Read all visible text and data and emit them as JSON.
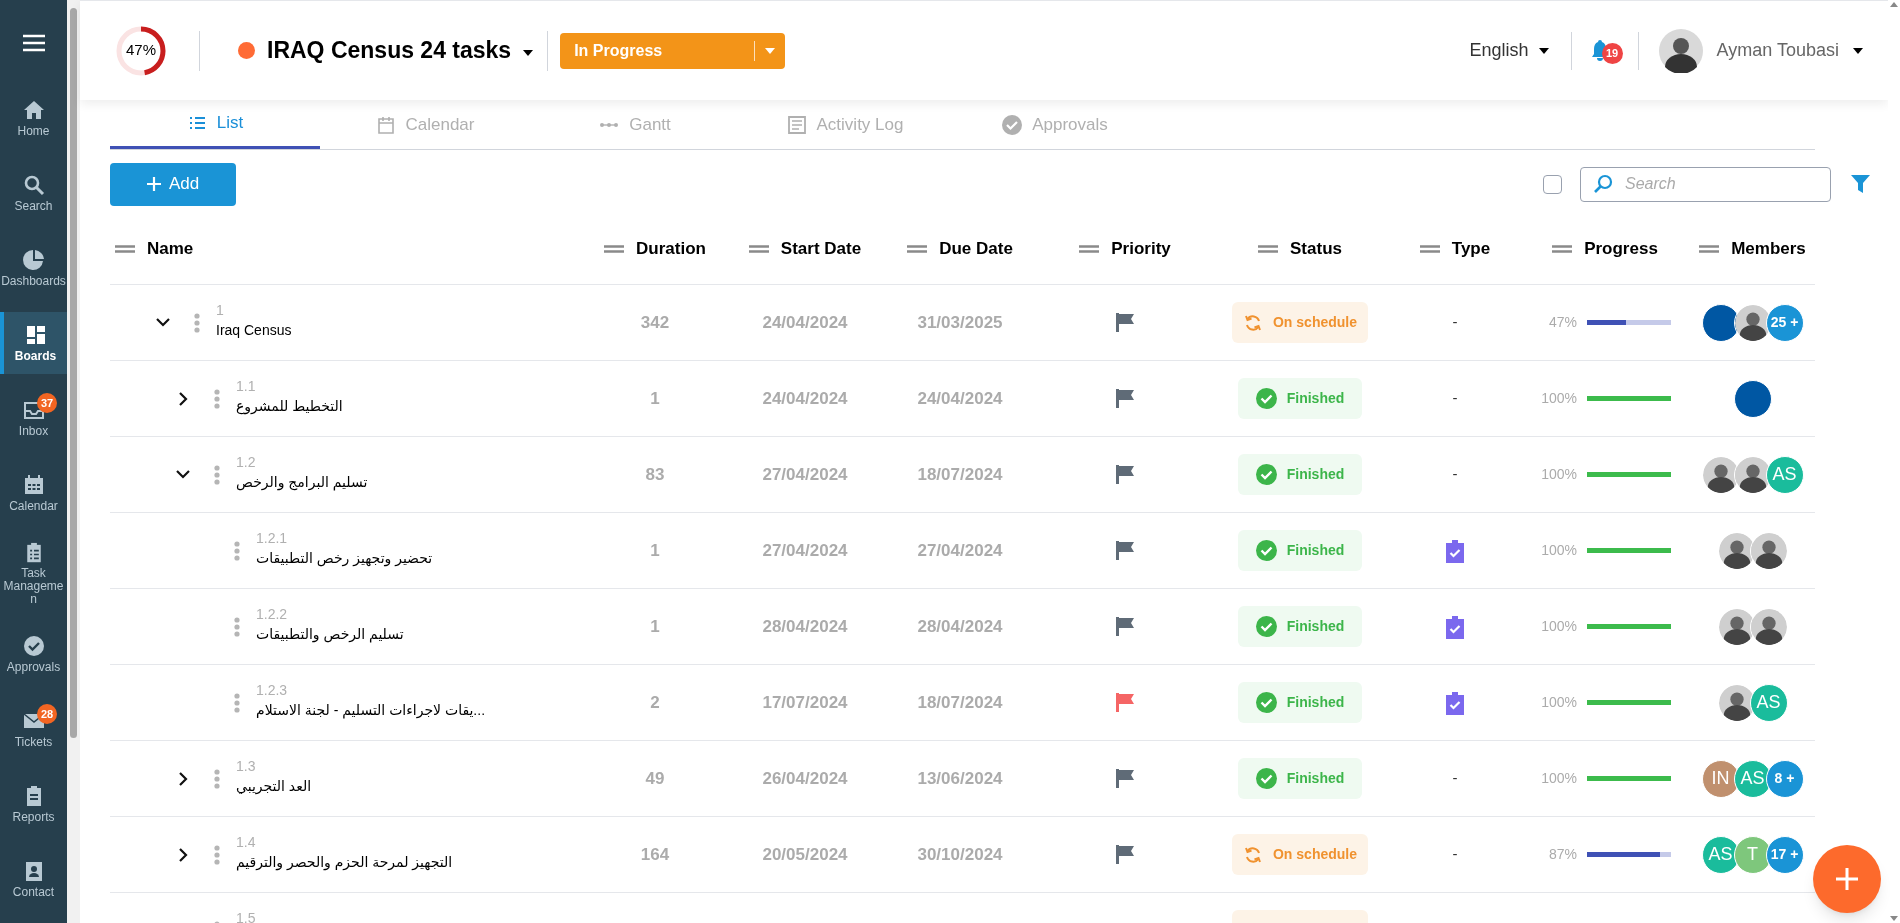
{
  "sidebar": {
    "items": [
      {
        "label": "Home",
        "selected": false
      },
      {
        "label": "Search",
        "selected": false
      },
      {
        "label": "Dashboards",
        "selected": false
      },
      {
        "label": "Boards",
        "selected": true
      },
      {
        "label": "Inbox",
        "selected": false,
        "badge": "37"
      },
      {
        "label": "Calendar",
        "selected": false
      },
      {
        "label": "Task Managemen",
        "selected": false
      },
      {
        "label": "Approvals",
        "selected": false
      },
      {
        "label": "Tickets",
        "selected": false,
        "badge": "28"
      },
      {
        "label": "Reports",
        "selected": false
      },
      {
        "label": "Contact",
        "selected": false
      }
    ]
  },
  "header": {
    "progress": {
      "text": "47%",
      "level": 0.47
    },
    "project_title": "IRAQ Census 24 tasks",
    "status_dropdown": "In Progress",
    "language": "English",
    "notifications": "19",
    "user_name": "Ayman Toubasi"
  },
  "tabs": [
    {
      "label": "List",
      "selected": true
    },
    {
      "label": "Calendar",
      "selected": false
    },
    {
      "label": "Gantt",
      "selected": false
    },
    {
      "label": "Activity Log",
      "selected": false
    },
    {
      "label": "Approvals",
      "selected": false
    }
  ],
  "toolbar": {
    "add_button": "Add",
    "select_all_checked": false,
    "search": {
      "placeholder": "Search"
    }
  },
  "table": {
    "columns": [
      "Name",
      "Duration",
      "Start Date",
      "Due Date",
      "Priority",
      "Status",
      "Type",
      "Progress",
      "Members"
    ],
    "rows": [
      {
        "number": "1",
        "name": "Iraq Census",
        "expanded": true,
        "duration": "342",
        "start": "24/04/2024",
        "due": "31/03/2025",
        "priority": {
          "kind": "normal"
        },
        "status": {
          "kind": "on_schedule",
          "label": "On schedule"
        },
        "type": {
          "kind": "dash",
          "text": "-"
        },
        "progress": {
          "text": "47%",
          "level": 0.47
        },
        "members": [
          {
            "kind": "plain",
            "color": "#0057a3"
          },
          {
            "kind": "photo"
          },
          {
            "kind": "more",
            "text": "25 +",
            "color": "#1a94d6"
          }
        ],
        "children": [
          {
            "number": "1.1",
            "name": "التخطيط للمشروع",
            "expanded": false,
            "duration": "1",
            "start": "24/04/2024",
            "due": "24/04/2024",
            "priority": {
              "kind": "normal"
            },
            "status": {
              "kind": "finished",
              "label": "Finished"
            },
            "type": {
              "kind": "dash",
              "text": "-"
            },
            "progress": {
              "text": "100%",
              "level": 1
            },
            "members": [
              {
                "kind": "plain",
                "color": "#0057a3"
              }
            ]
          },
          {
            "number": "1.2",
            "name": "تسليم البرامج والرخص",
            "expanded": true,
            "duration": "83",
            "start": "27/04/2024",
            "due": "18/07/2024",
            "priority": {
              "kind": "normal"
            },
            "status": {
              "kind": "finished",
              "label": "Finished"
            },
            "type": {
              "kind": "dash",
              "text": "-"
            },
            "progress": {
              "text": "100%",
              "level": 1
            },
            "members": [
              {
                "kind": "photo"
              },
              {
                "kind": "photo"
              },
              {
                "kind": "initials",
                "text": "AS",
                "color": "#1abc9c"
              }
            ],
            "children": [
              {
                "number": "1.2.1",
                "name": "تحضير وتجهيز رخص التطبيقات",
                "duration": "1",
                "start": "27/04/2024",
                "due": "27/04/2024",
                "priority": {
                  "kind": "normal"
                },
                "status": {
                  "kind": "finished",
                  "label": "Finished"
                },
                "type": {
                  "kind": "task"
                },
                "progress": {
                  "text": "100%",
                  "level": 1
                },
                "members": [
                  {
                    "kind": "photo"
                  },
                  {
                    "kind": "photo"
                  }
                ]
              },
              {
                "number": "1.2.2",
                "name": "تسليم الرخص والتطبيقات",
                "duration": "1",
                "start": "28/04/2024",
                "due": "28/04/2024",
                "priority": {
                  "kind": "normal"
                },
                "status": {
                  "kind": "finished",
                  "label": "Finished"
                },
                "type": {
                  "kind": "task"
                },
                "progress": {
                  "text": "100%",
                  "level": 1
                },
                "members": [
                  {
                    "kind": "photo"
                  },
                  {
                    "kind": "photo"
                  }
                ]
              },
              {
                "number": "1.2.3",
                "name": "...يقات لاجراءات التسليم - لجنة الاستلام",
                "duration": "2",
                "start": "17/07/2024",
                "due": "18/07/2024",
                "priority": {
                  "kind": "urgent"
                },
                "status": {
                  "kind": "finished",
                  "label": "Finished"
                },
                "type": {
                  "kind": "task"
                },
                "progress": {
                  "text": "100%",
                  "level": 1
                },
                "members": [
                  {
                    "kind": "photo"
                  },
                  {
                    "kind": "initials",
                    "text": "AS",
                    "color": "#1abc9c"
                  }
                ]
              }
            ]
          },
          {
            "number": "1.3",
            "name": "العد التجريبي",
            "expanded": false,
            "duration": "49",
            "start": "26/04/2024",
            "due": "13/06/2024",
            "priority": {
              "kind": "normal"
            },
            "status": {
              "kind": "finished",
              "label": "Finished"
            },
            "type": {
              "kind": "dash",
              "text": "-"
            },
            "progress": {
              "text": "100%",
              "level": 1
            },
            "members": [
              {
                "kind": "initials",
                "text": "IN",
                "color": "#c0906e"
              },
              {
                "kind": "initials",
                "text": "AS",
                "color": "#1abc9c"
              },
              {
                "kind": "more",
                "text": "8 +",
                "color": "#1a94d6"
              }
            ]
          },
          {
            "number": "1.4",
            "name": "التجهيز لمرحة الحزم والحصر والترقيم",
            "expanded": false,
            "duration": "164",
            "start": "20/05/2024",
            "due": "30/10/2024",
            "priority": {
              "kind": "normal"
            },
            "status": {
              "kind": "on_schedule",
              "label": "On schedule"
            },
            "type": {
              "kind": "dash",
              "text": "-"
            },
            "progress": {
              "text": "87%",
              "level": 0.87
            },
            "members": [
              {
                "kind": "initials",
                "text": "AS",
                "color": "#1abc9c"
              },
              {
                "kind": "initials",
                "text": "T",
                "color": "#7ec77c"
              },
              {
                "kind": "more",
                "text": "17 +",
                "color": "#1a94d6"
              }
            ]
          },
          {
            "number": "1.5",
            "status": {
              "kind": "on_schedule"
            }
          }
        ]
      }
    ]
  }
}
